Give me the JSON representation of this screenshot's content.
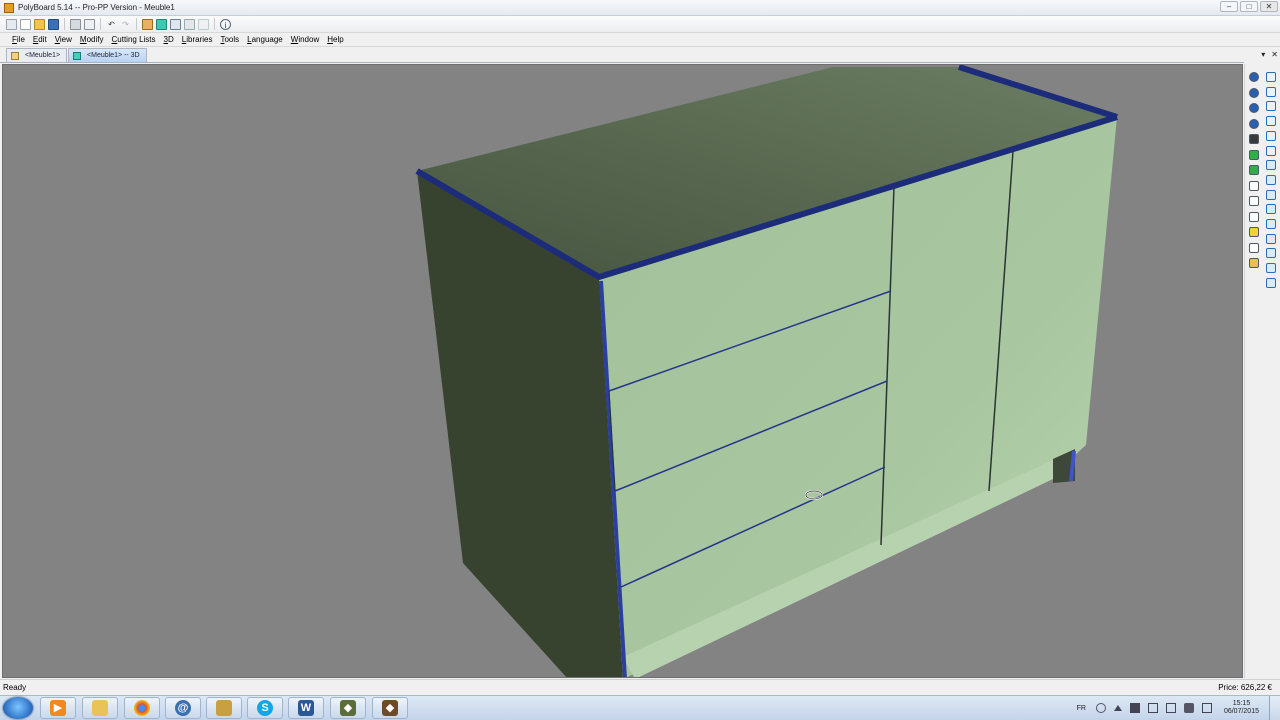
{
  "window": {
    "title": "PolyBoard 5.14 -- Pro-PP Version - Meuble1",
    "minimize_label": "–",
    "maximize_label": "□",
    "close_label": "✕"
  },
  "toolbar": {
    "icons": [
      "new-icon",
      "new-doc-icon",
      "open-icon",
      "save-icon",
      "print-icon",
      "print-preview-icon",
      "undo-icon",
      "redo-icon",
      "export-icon",
      "view-3d-icon",
      "window-tile-icon",
      "window-cascade-icon",
      "window-arrange-icon",
      "info-icon"
    ]
  },
  "menu": {
    "items": [
      {
        "name": "File",
        "underline": "F",
        "rest": "ile"
      },
      {
        "name": "Edit",
        "underline": "E",
        "rest": "dit"
      },
      {
        "name": "View",
        "underline": "V",
        "rest": "iew"
      },
      {
        "name": "Modify",
        "underline": "M",
        "rest": "odify"
      },
      {
        "name": "Cutting Lists",
        "underline": "C",
        "rest": "utting Lists"
      },
      {
        "name": "3D",
        "underline": "3",
        "rest": "D"
      },
      {
        "name": "Libraries",
        "underline": "L",
        "rest": "ibraries"
      },
      {
        "name": "Tools",
        "underline": "T",
        "rest": "ools"
      },
      {
        "name": "Language",
        "underline": "L",
        "rest": "anguage"
      },
      {
        "name": "Window",
        "underline": "W",
        "rest": "indow"
      },
      {
        "name": "Help",
        "underline": "H",
        "rest": "elp"
      }
    ]
  },
  "tabs": [
    {
      "label": "<Meuble1>",
      "active": false
    },
    {
      "label": "<Meuble1> -- 3D",
      "active": true
    }
  ],
  "tab_controls": {
    "dropdown": "▾",
    "close": "✕"
  },
  "statusbar": {
    "left": "Ready",
    "right": "Price: 626,22 €"
  },
  "taskbar": {
    "apps": [
      "media-player-icon",
      "file-explorer-icon",
      "chrome-icon",
      "thunderbird-icon",
      "archive-icon",
      "skype-icon",
      "word-icon",
      "polyboard-icon",
      "optimiser-icon"
    ],
    "language": "FR",
    "time": "15:15",
    "date": "06/07/2015"
  },
  "colors": {
    "viewport_bg": "#838383",
    "cabinet_front": "#a7c49f",
    "cabinet_side": "#3a4536",
    "cabinet_top": "#4f5f4a",
    "edge_blue": "#1c2c7a"
  }
}
